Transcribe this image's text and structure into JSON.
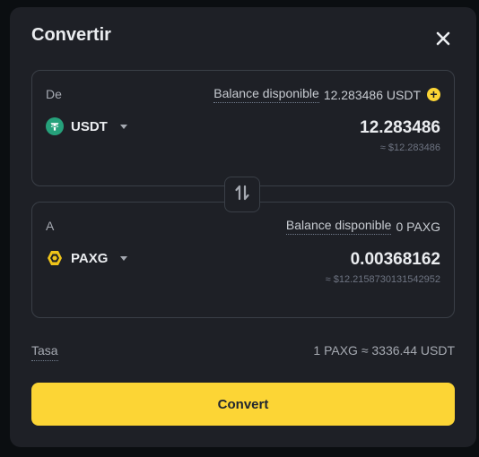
{
  "modal": {
    "title": "Convertir",
    "close_icon": "close-icon"
  },
  "from": {
    "label": "De",
    "balance_label": "Balance disponible",
    "balance_value": "12.283486 USDT",
    "add_icon": "plus-circle-icon",
    "coin": "USDT",
    "coin_icon": "usdt-icon",
    "amount": "12.283486",
    "approx": "≈ $12.283486"
  },
  "swap": {
    "icon": "swap-vertical-icon"
  },
  "to": {
    "label": "A",
    "balance_label": "Balance disponible",
    "balance_value": "0 PAXG",
    "coin": "PAXG",
    "coin_icon": "paxg-icon",
    "amount": "0.00368162",
    "approx": "≈ $12.2158730131542952"
  },
  "rate": {
    "label": "Tasa",
    "value": "1 PAXG ≈ 3336.44 USDT"
  },
  "convert_button": {
    "label": "Convert"
  },
  "colors": {
    "background": "#0b0e11",
    "modal": "#1e2026",
    "accent": "#fcd535",
    "usdt": "#26a17b",
    "text_primary": "#eaecef",
    "text_secondary": "#a5a9b1"
  }
}
